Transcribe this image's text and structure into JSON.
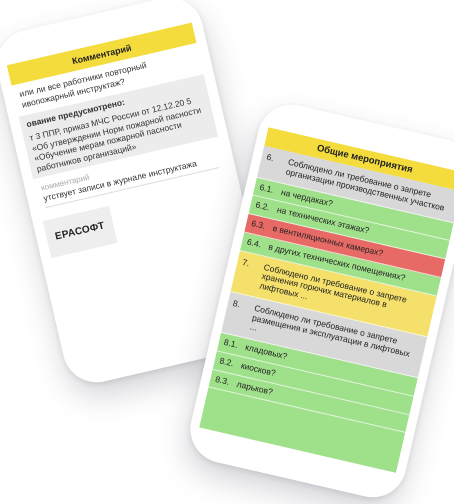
{
  "comment_screen": {
    "header": "Комментарий",
    "question": "или ли все работники повторный ивопожарный инструктаж?",
    "section_title": "ование предусмотрено:",
    "section_text": "т 3 ППР, приказ МЧС России от 12.12.20 5 «Об утверждении Норм пожарной пасности «Обучение мерам пожарной пасности работников организаций»",
    "input_label": "комментарий",
    "input_value": "утствует записи в журнале инструктажа",
    "logo_text": "ЕРАСОФТ"
  },
  "checklist_screen": {
    "header": "Общие мероприятия",
    "rows": [
      {
        "num": "6.",
        "text": "Соблюдено ли требование о запрете организации производственных участков",
        "color": "#d8d8d8"
      },
      {
        "num": "6.1.",
        "text": "на чердаках?",
        "color": "#9fe08a"
      },
      {
        "num": "6.2.",
        "text": "на технических этажах?",
        "color": "#9fe08a"
      },
      {
        "num": "6.3.",
        "text": "в вентиляционных камерах?",
        "color": "#e86a66"
      },
      {
        "num": "6.4.",
        "text": "в других технических помещениях?",
        "color": "#9fe08a"
      },
      {
        "num": "7.",
        "text": "Соблюдено ли требование о запрете хранения горючих материалов в лифтовых ...",
        "color": "#f4e06a"
      },
      {
        "num": "8.",
        "text": "Соблюдено ли требование о запрете размещения и эксплуатации в лифтовых ...",
        "color": "#d8d8d8"
      },
      {
        "num": "8.1.",
        "text": "кладовых?",
        "color": "#9fe08a"
      },
      {
        "num": "8.2.",
        "text": "киосков?",
        "color": "#9fe08a"
      },
      {
        "num": "8.3.",
        "text": "ларьков?",
        "color": "#9fe08a"
      }
    ]
  }
}
